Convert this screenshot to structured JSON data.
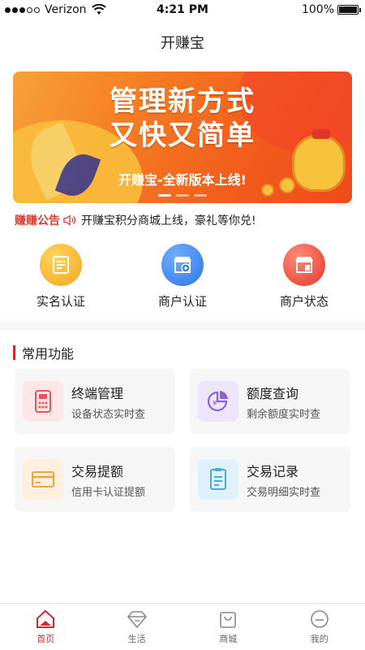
{
  "status_bar": {
    "carrier": "Verizon",
    "time": "4:21 PM",
    "battery": "100%",
    "battery_level": 1.0
  },
  "nav": {
    "title": "开赚宝"
  },
  "banner": {
    "title_line1": "管理新方式",
    "title_line2": "又快又简单",
    "subtitle": "开赚宝-全新版本上线!",
    "active_slide": 1,
    "slide_count": 3
  },
  "notice": {
    "label": "赚赚公告",
    "text": "开赚宝积分商城上线，豪礼等你兑!"
  },
  "auth": [
    {
      "label": "实名认证",
      "icon": "id-card-icon",
      "color": "#f6b42c"
    },
    {
      "label": "商户认证",
      "icon": "shop-plus-icon",
      "color": "#3a86f0"
    },
    {
      "label": "商户状态",
      "icon": "shop-status-icon",
      "color": "#ee4b3a"
    }
  ],
  "section": {
    "title": "常用功能"
  },
  "features": [
    {
      "title": "终端管理",
      "desc": "设备状态实时查",
      "icon": "pos-terminal-icon",
      "color": "#e8545a",
      "bg": "#fde6e6"
    },
    {
      "title": "额度查询",
      "desc": "剩余额度实时查",
      "icon": "pie-yuan-icon",
      "color": "#8a63d8",
      "bg": "#ece5fb"
    },
    {
      "title": "交易提额",
      "desc": "信用卡认证提额",
      "icon": "credit-card-icon",
      "color": "#f0a23c",
      "bg": "#fdf0de"
    },
    {
      "title": "交易记录",
      "desc": "交易明细实时查",
      "icon": "record-list-icon",
      "color": "#4aa8e8",
      "bg": "#e1f1fc"
    }
  ],
  "tabs": [
    {
      "label": "首页",
      "icon": "home-icon",
      "active": true
    },
    {
      "label": "生活",
      "icon": "diamond-icon",
      "active": false
    },
    {
      "label": "商城",
      "icon": "shopping-bag-icon",
      "active": false
    },
    {
      "label": "我的",
      "icon": "profile-icon",
      "active": false
    }
  ],
  "colors": {
    "accent": "#d7282a",
    "notice_red": "#e03a2c"
  }
}
